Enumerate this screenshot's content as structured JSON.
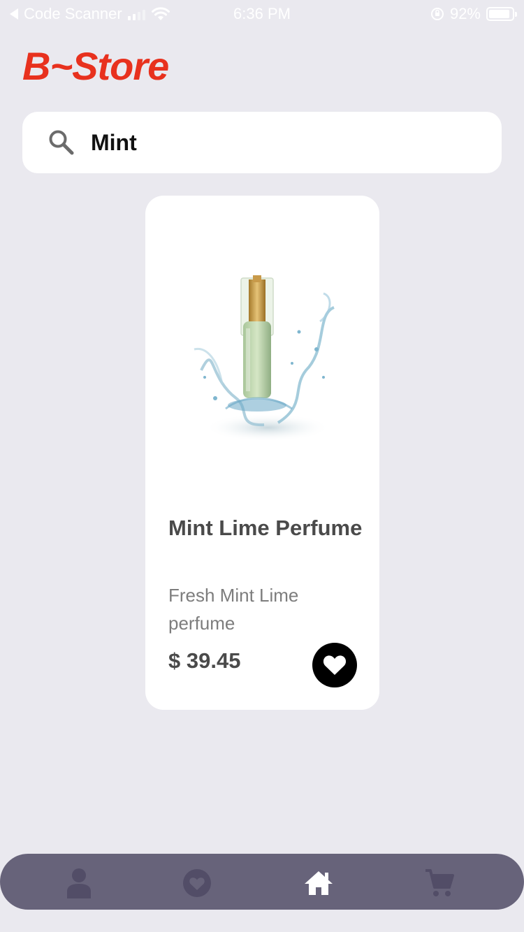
{
  "status_bar": {
    "back_app": "Code Scanner",
    "time": "6:36 PM",
    "battery": "92%",
    "battery_level": 0.92
  },
  "brand": {
    "title": "B~Store",
    "color": "#e8311e"
  },
  "search": {
    "value": "Mint",
    "icon": "search-icon"
  },
  "products": [
    {
      "name": "Mint Lime Perfume",
      "description": "Fresh Mint Lime perfume",
      "price": "$ 39.45",
      "image": "perfume-bottle-image",
      "favorite_icon": "heart-icon"
    }
  ],
  "bottom_nav": {
    "background": "#67637a",
    "items": [
      {
        "icon": "user-icon",
        "active": false
      },
      {
        "icon": "heart-icon",
        "active": false
      },
      {
        "icon": "home-icon",
        "active": true
      },
      {
        "icon": "cart-icon",
        "active": false
      }
    ]
  }
}
